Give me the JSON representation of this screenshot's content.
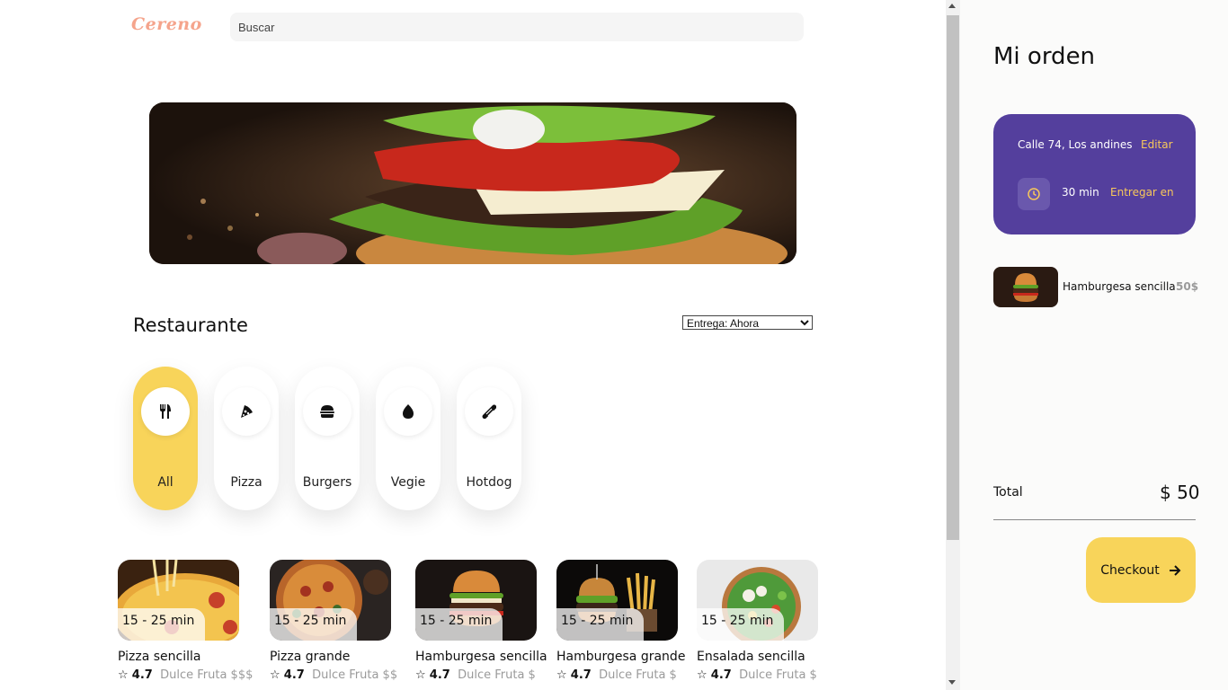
{
  "brand": {
    "logo": "Cereno"
  },
  "search": {
    "placeholder": "Buscar"
  },
  "section": {
    "title": "Restaurante",
    "delivery_option": "Entrega: Ahora"
  },
  "categories": [
    {
      "label": "All",
      "icon": "fork-knife-icon",
      "active": true
    },
    {
      "label": "Pizza",
      "icon": "pizza-icon",
      "active": false
    },
    {
      "label": "Burgers",
      "icon": "burger-icon",
      "active": false
    },
    {
      "label": "Vegie",
      "icon": "egg-icon",
      "active": false
    },
    {
      "label": "Hotdog",
      "icon": "hotdog-icon",
      "active": false
    }
  ],
  "items": [
    {
      "name": "Pizza sencilla",
      "time": "15 - 25 min",
      "rating": "4.7",
      "tags": "Dulce  Fruta  $$$"
    },
    {
      "name": "Pizza grande",
      "time": "15 - 25 min",
      "rating": "4.7",
      "tags": "Dulce  Fruta  $$"
    },
    {
      "name": "Hamburgesa sencilla",
      "time": "15 - 25 min",
      "rating": "4.7",
      "tags": "Dulce  Fruta  $"
    },
    {
      "name": "Hamburgesa grande",
      "time": "15 - 25 min",
      "rating": "4.7",
      "tags": "Dulce  Fruta  $"
    },
    {
      "name": "Ensalada sencilla",
      "time": "15 - 25 min",
      "rating": "4.7",
      "tags": "Dulce  Fruta  $"
    }
  ],
  "order": {
    "title": "Mi orden",
    "address": "Calle 74, Los andines",
    "edit": "Editar",
    "time": "30 min",
    "deliver": "Entregar en",
    "line_item": {
      "name": "Hamburgesa sencilla",
      "price": "50$"
    },
    "total_label": "Total",
    "total_value": "$ 50",
    "checkout": "Checkout"
  },
  "colors": {
    "accent": "#f8d45a",
    "card": "#543f9d",
    "link": "#f8c85a",
    "logo": "#f5a48c"
  }
}
